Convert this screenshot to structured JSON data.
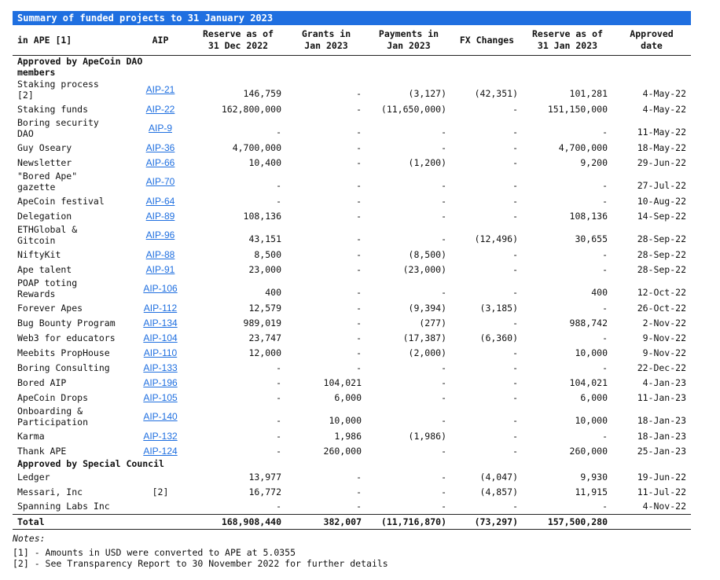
{
  "title": "Summary of funded projects to 31 January 2023",
  "headers": {
    "project": "in APE [1]",
    "aip": "AIP",
    "reserve_dec": [
      "Reserve as of",
      "31 Dec 2022"
    ],
    "grants": [
      "Grants in",
      "Jan 2023"
    ],
    "payments": [
      "Payments in",
      "Jan 2023"
    ],
    "fx": "FX Changes",
    "reserve_jan": [
      "Reserve as of",
      "31 Jan 2023"
    ],
    "approved": "Approved date"
  },
  "section_dao": [
    "Approved by ApeCoin DAO",
    "members"
  ],
  "dao_rows": [
    {
      "name": [
        "Staking process",
        "[2]"
      ],
      "aip": "AIP-21",
      "rdec": "146,759",
      "grants": "-",
      "pay": "(3,127)",
      "fx": "(42,351)",
      "rjan": "101,281",
      "date": "4-May-22"
    },
    {
      "name": [
        "Staking funds"
      ],
      "aip": "AIP-22",
      "rdec": "162,800,000",
      "grants": "-",
      "pay": "(11,650,000)",
      "fx": "-",
      "rjan": "151,150,000",
      "date": "4-May-22"
    },
    {
      "name": [
        "Boring security",
        "DAO"
      ],
      "aip": "AIP-9",
      "rdec": "-",
      "grants": "-",
      "pay": "-",
      "fx": "-",
      "rjan": "-",
      "date": "11-May-22"
    },
    {
      "name": [
        "Guy Oseary"
      ],
      "aip": "AIP-36",
      "rdec": "4,700,000",
      "grants": "-",
      "pay": "-",
      "fx": "-",
      "rjan": "4,700,000",
      "date": "18-May-22"
    },
    {
      "name": [
        "Newsletter"
      ],
      "aip": "AIP-66",
      "rdec": "10,400",
      "grants": "-",
      "pay": "(1,200)",
      "fx": "-",
      "rjan": "9,200",
      "date": "29-Jun-22"
    },
    {
      "name": [
        "\"Bored Ape\"",
        "gazette"
      ],
      "aip": "AIP-70",
      "rdec": "-",
      "grants": "-",
      "pay": "-",
      "fx": "-",
      "rjan": "-",
      "date": "27-Jul-22"
    },
    {
      "name": [
        "ApeCoin festival"
      ],
      "aip": "AIP-64",
      "rdec": "-",
      "grants": "-",
      "pay": "-",
      "fx": "-",
      "rjan": "-",
      "date": "10-Aug-22"
    },
    {
      "name": [
        "Delegation"
      ],
      "aip": "AIP-89",
      "rdec": "108,136",
      "grants": "-",
      "pay": "-",
      "fx": "-",
      "rjan": "108,136",
      "date": "14-Sep-22"
    },
    {
      "name": [
        "ETHGlobal &",
        "Gitcoin"
      ],
      "aip": "AIP-96",
      "rdec": "43,151",
      "grants": "-",
      "pay": "-",
      "fx": "(12,496)",
      "rjan": "30,655",
      "date": "28-Sep-22"
    },
    {
      "name": [
        "NiftyKit"
      ],
      "aip": "AIP-88",
      "rdec": "8,500",
      "grants": "-",
      "pay": "(8,500)",
      "fx": "-",
      "rjan": "-",
      "date": "28-Sep-22"
    },
    {
      "name": [
        "Ape talent"
      ],
      "aip": "AIP-91",
      "rdec": "23,000",
      "grants": "-",
      "pay": "(23,000)",
      "fx": "-",
      "rjan": "-",
      "date": "28-Sep-22"
    },
    {
      "name": [
        "POAP toting",
        "Rewards"
      ],
      "aip": "AIP-106",
      "rdec": "400",
      "grants": "-",
      "pay": "-",
      "fx": "-",
      "rjan": "400",
      "date": "12-Oct-22"
    },
    {
      "name": [
        "Forever Apes"
      ],
      "aip": "AIP-112",
      "rdec": "12,579",
      "grants": "-",
      "pay": "(9,394)",
      "fx": "(3,185)",
      "rjan": "-",
      "date": "26-Oct-22"
    },
    {
      "name": [
        "Bug Bounty Program"
      ],
      "aip": "AIP-134",
      "rdec": "989,019",
      "grants": "-",
      "pay": "(277)",
      "fx": "-",
      "rjan": "988,742",
      "date": "2-Nov-22"
    },
    {
      "name": [
        "Web3 for educators"
      ],
      "aip": "AIP-104",
      "rdec": "23,747",
      "grants": "-",
      "pay": "(17,387)",
      "fx": "(6,360)",
      "rjan": "-",
      "date": "9-Nov-22"
    },
    {
      "name": [
        "Meebits PropHouse"
      ],
      "aip": "AIP-110",
      "rdec": "12,000",
      "grants": "-",
      "pay": "(2,000)",
      "fx": "-",
      "rjan": "10,000",
      "date": "9-Nov-22"
    },
    {
      "name": [
        "Boring Consulting"
      ],
      "aip": "AIP-133",
      "rdec": "-",
      "grants": "-",
      "pay": "-",
      "fx": "-",
      "rjan": "-",
      "date": "22-Dec-22"
    },
    {
      "name": [
        "Bored AIP"
      ],
      "aip": "AIP-196",
      "rdec": "-",
      "grants": "104,021",
      "pay": "-",
      "fx": "-",
      "rjan": "104,021",
      "date": "4-Jan-23"
    },
    {
      "name": [
        "ApeCoin Drops"
      ],
      "aip": "AIP-105",
      "rdec": "-",
      "grants": "6,000",
      "pay": "-",
      "fx": "-",
      "rjan": "6,000",
      "date": "11-Jan-23"
    },
    {
      "name": [
        "Onboarding &",
        "Participation"
      ],
      "aip": "AIP-140",
      "rdec": "-",
      "grants": "10,000",
      "pay": "-",
      "fx": "-",
      "rjan": "10,000",
      "date": "18-Jan-23"
    },
    {
      "name": [
        "Karma"
      ],
      "aip": "AIP-132",
      "rdec": "-",
      "grants": "1,986",
      "pay": "(1,986)",
      "fx": "-",
      "rjan": "-",
      "date": "18-Jan-23"
    },
    {
      "name": [
        "Thank APE"
      ],
      "aip": "AIP-124",
      "rdec": "-",
      "grants": "260,000",
      "pay": "-",
      "fx": "-",
      "rjan": "260,000",
      "date": "25-Jan-23"
    }
  ],
  "section_council": "Approved by Special Council",
  "council_rows": [
    {
      "name": [
        "Ledger"
      ],
      "aip": "",
      "rdec": "13,977",
      "grants": "-",
      "pay": "-",
      "fx": "(4,047)",
      "rjan": "9,930",
      "date": "19-Jun-22"
    },
    {
      "name": [
        "Messari, Inc"
      ],
      "aip": "[2]",
      "rdec": "16,772",
      "grants": "-",
      "pay": "-",
      "fx": "(4,857)",
      "rjan": "11,915",
      "date": "11-Jul-22"
    },
    {
      "name": [
        "Spanning Labs Inc"
      ],
      "aip": "",
      "rdec": "-",
      "grants": "-",
      "pay": "-",
      "fx": "-",
      "rjan": "-",
      "date": "4-Nov-22"
    }
  ],
  "total": {
    "label": "Total",
    "rdec": "168,908,440",
    "grants": "382,007",
    "pay": "(11,716,870)",
    "fx": "(73,297)",
    "rjan": "157,500,280",
    "date": ""
  },
  "notes": {
    "header": "Notes:",
    "items": [
      "[1] - Amounts in USD were converted to APE at 5.0355",
      "[2] - See Transparency Report to 30 November 2022 for further details"
    ]
  }
}
